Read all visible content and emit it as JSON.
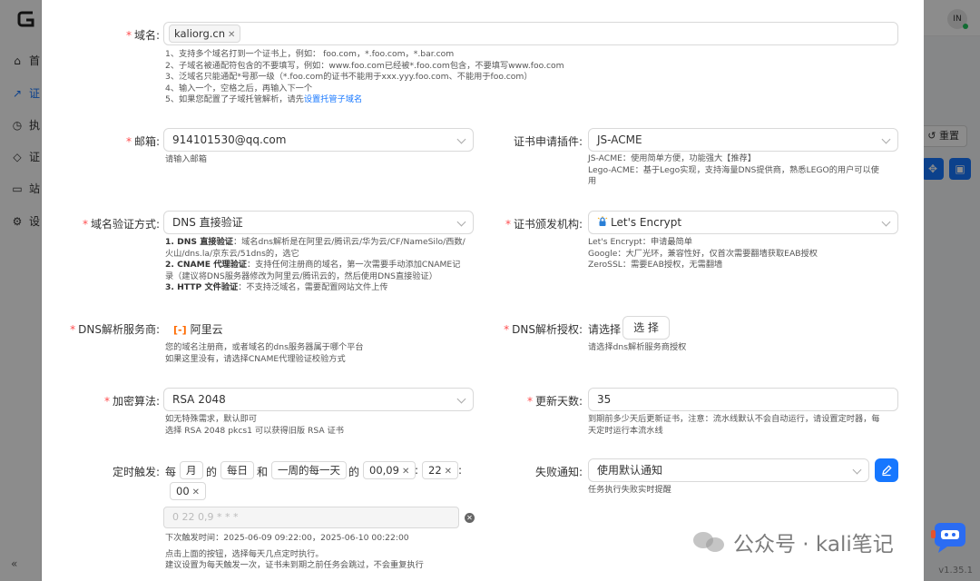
{
  "app": {
    "nav": [
      {
        "label": "首",
        "icon": "home-icon"
      },
      {
        "label": "证",
        "icon": "trend-icon"
      },
      {
        "label": "执",
        "icon": "history-icon"
      },
      {
        "label": "证",
        "icon": "shield-icon"
      },
      {
        "label": "站",
        "icon": "camera-icon"
      },
      {
        "label": "设",
        "icon": "gear-icon"
      }
    ],
    "avatar": "IN",
    "reset_label": "重置",
    "version": "v1.35.1",
    "collapse": "«"
  },
  "form": {
    "domain": {
      "label": "域名:",
      "tag": "kaliorg.cn",
      "help": [
        "1、支持多个域名打到一个证书上，例如： foo.com，*.foo.com，*.bar.com",
        "2、子域名被通配符包含的不要填写，例如：www.foo.com已经被*.foo.com包含，不要填写www.foo.com",
        "3、泛域名只能通配*号那一级（*.foo.com的证书不能用于xxx.yyy.foo.com、不能用于foo.com）",
        "4、输入一个，空格之后，再输入下一个"
      ],
      "help5_prefix": "5、如果您配置了子域托管解析，请先",
      "help5_link": "设置托管子域名"
    },
    "email": {
      "label": "邮箱:",
      "value": "914101530@qq.com",
      "help": "请输入邮箱"
    },
    "plugin": {
      "label": "证书申请插件:",
      "value": "JS-ACME",
      "help": [
        "JS-ACME：使用简单方便，功能强大【推荐】",
        "Lego-ACME：基于Lego实现，支持海量DNS提供商，熟悉LEGO的用户可以使",
        "用"
      ]
    },
    "verify": {
      "label": "域名验证方式:",
      "value": "DNS 直接验证",
      "help": [
        {
          "b": "1. DNS 直接验证",
          "t": "：域名dns解析是在阿里云/腾讯云/华为云/CF/NameSilo/西数/"
        },
        {
          "b": "",
          "t": "火山/dns.la/京东云/51dns的，选它"
        },
        {
          "b": "2. CNAME 代理验证",
          "t": "：支持任何注册商的域名，第一次需要手动添加CNAME记"
        },
        {
          "b": "",
          "t": "录（建议将DNS服务器修改为阿里云/腾讯云的，然后使用DNS直接验证）"
        },
        {
          "b": "3. HTTP 文件验证",
          "t": "：不支持泛域名，需要配置网站文件上传"
        }
      ]
    },
    "ca": {
      "label": "证书颁发机构:",
      "value": "Let's Encrypt",
      "help": [
        "Let's Encrypt：申请最简单",
        "Google：大厂光环，兼容性好，仅首次需要翻墙获取EAB授权",
        "ZeroSSL：需要EAB授权，无需翻墙"
      ]
    },
    "dns_provider": {
      "label": "DNS解析服务商:",
      "value": "阿里云",
      "help": [
        "您的域名注册商，或者域名的dns服务器属于哪个平台",
        "如果这里没有，请选择CNAME代理验证校验方式"
      ]
    },
    "dns_auth": {
      "label": "DNS解析授权:",
      "prompt": "请选择",
      "button": "选 择",
      "help": "请选择dns解析服务商授权"
    },
    "algo": {
      "label": "加密算法:",
      "value": "RSA 2048",
      "help": [
        "如无特殊需求，默认即可",
        "选择 RSA 2048 pkcs1 可以获得旧版 RSA 证书"
      ]
    },
    "renew": {
      "label": "更新天数:",
      "value": "35",
      "help": [
        "到期前多少天后更新证书，注意：流水线默认不会自动运行，请设置定时器，每",
        "天定时运行本流水线"
      ]
    },
    "schedule": {
      "label": "定时触发:",
      "w1": "每",
      "month": "月",
      "w2": "的",
      "day": "每日",
      "w3": "和",
      "week": "一周的每一天",
      "w4": "的",
      "hour": "00,09",
      "colon1": ":",
      "minute": "22",
      "colon2": ":",
      "second": "00",
      "cron": "0 22 0,9 * * *",
      "help": [
        "下次触发时间：2025-06-09 09:22:00，2025-06-10 00:22:00",
        "点击上面的按钮，选择每天几点定时执行。",
        "建议设置为每天触发一次，证书未到期之前任务会跳过，不会重复执行"
      ]
    },
    "notify": {
      "label": "失败通知:",
      "value": "使用默认通知",
      "help": "任务执行失败实时提醒"
    }
  },
  "watermark": {
    "text": "公众号 · kali笔记"
  },
  "colors": {
    "primary": "#1677ff",
    "required": "#ff4d4f",
    "aliyun": "#ff6a00"
  }
}
